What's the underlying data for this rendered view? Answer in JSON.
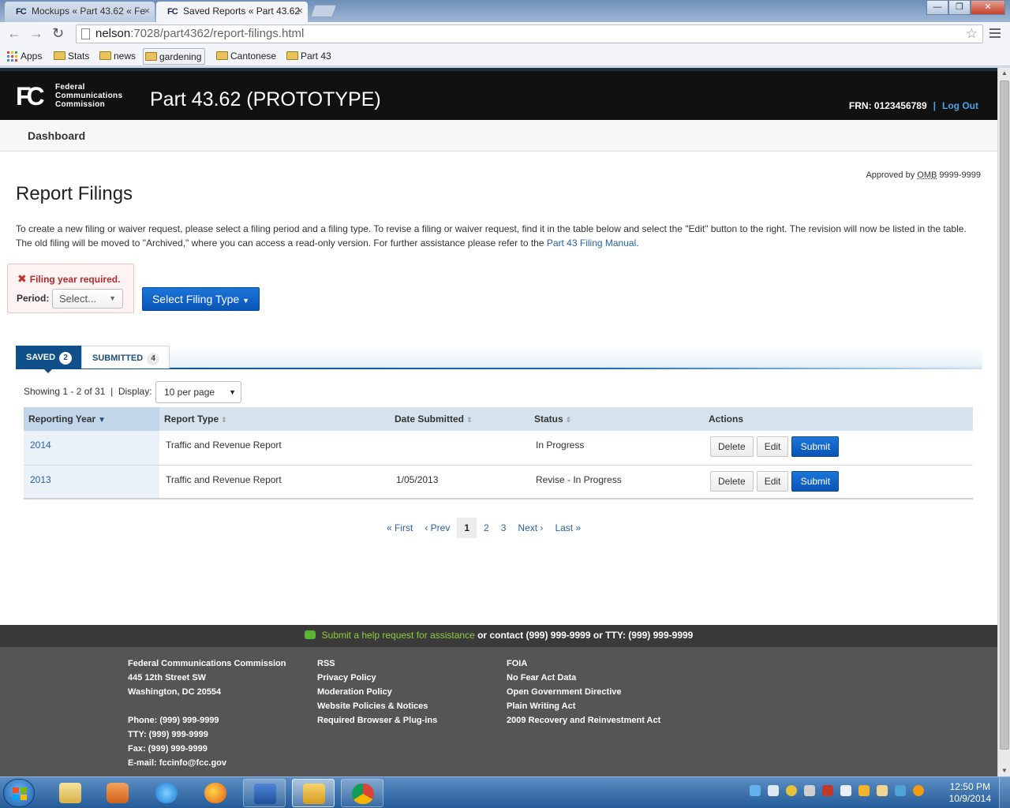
{
  "browser": {
    "tabs": [
      {
        "favicon": "FC",
        "title": "Mockups « Part 43.62 « Fe"
      },
      {
        "favicon": "FC",
        "title": "Saved Reports « Part 43.62"
      }
    ],
    "close_glyph": "×",
    "url_host": "nelson",
    "url_path": ":7028/part4362/report-filings.html",
    "bookmarks": [
      "Apps",
      "Stats",
      "news",
      "gardening",
      "Cantonese",
      "Part 43"
    ]
  },
  "header": {
    "agency_line1": "Federal",
    "agency_line2": "Communications",
    "agency_line3": "Commission",
    "logo_mark": "FC",
    "app_title": "Part 43.62 (PROTOTYPE)",
    "frn": "FRN: 0123456789",
    "separator": "|",
    "logout": "Log Out"
  },
  "nav": {
    "dashboard": "Dashboard"
  },
  "page": {
    "omb_prefix": "Approved by ",
    "omb_abbr": "OMB",
    "omb_number": " 9999-9999",
    "title": "Report Filings",
    "intro_text": "To create a new filing or waiver request, please select a filing period and a filing type. To revise a filing or waiver request, find it in the table below and select the \"Edit\" button to the right. The revision will now be listed in the table. The old filing will be moved to \"Archived,\" where you can access a read-only version. For further assistance please refer to the ",
    "intro_link": "Part 43 Filing Manual",
    "intro_end": "."
  },
  "form": {
    "error_icon": "✖",
    "error": "Filing year required.",
    "period_label": "Period:",
    "period_value": "Select...",
    "filing_type_button": "Select Filing Type"
  },
  "tabs": {
    "saved_label": "SAVED",
    "saved_count": "2",
    "submitted_label": "SUBMITTED",
    "submitted_count": "4"
  },
  "listing": {
    "showing": "Showing 1 - 2 of 31  |  Display:",
    "per_page": "10 per page"
  },
  "table": {
    "columns": [
      "Reporting Year",
      "Report Type",
      "Date Submitted",
      "Status",
      "Actions"
    ],
    "rows": [
      {
        "year": "2014",
        "type": "Traffic and Revenue Report",
        "date": "",
        "status": "In Progress"
      },
      {
        "year": "2013",
        "type": "Traffic and Revenue Report",
        "date": "1/05/2013",
        "status": "Revise - In Progress"
      }
    ],
    "actions": {
      "delete": "Delete",
      "edit": "Edit",
      "submit": "Submit"
    }
  },
  "pagination": {
    "first": "« First",
    "prev": "‹ Prev",
    "pages": [
      "1",
      "2",
      "3"
    ],
    "next": "Next ›",
    "last": "Last »"
  },
  "help": {
    "link": "Submit a help request for assistance",
    "text": " or contact (999) 999-9999 or TTY: (999) 999-9999"
  },
  "footer": {
    "col1": [
      "Federal Communications Commission",
      "445 12th Street SW",
      "Washington, DC 20554",
      "",
      "Phone: (999) 999-9999",
      "TTY: (999) 999-9999",
      "Fax: (999) 999-9999",
      "E-mail: fccinfo@fcc.gov"
    ],
    "col2": [
      "RSS",
      "Privacy Policy",
      "Moderation Policy",
      "Website Policies & Notices",
      "Required Browser & Plug-ins"
    ],
    "col3": [
      "FOIA",
      "No Fear Act Data",
      "Open Government Directive",
      "Plain Writing Act",
      "2009 Recovery and Reinvestment Act"
    ]
  },
  "taskbar": {
    "apps": [
      "explorer-icon",
      "media-player-icon",
      "internet-explorer-icon",
      "firefox-icon",
      "word-icon",
      "outlook-icon",
      "chrome-icon"
    ],
    "time": "12:50 PM",
    "date": "10/9/2014"
  },
  "colors": {
    "brand_blue": "#0f4f8a",
    "link_blue": "#2862a8",
    "primary_button": "#0a55b8",
    "error_red": "#b52b2b"
  }
}
